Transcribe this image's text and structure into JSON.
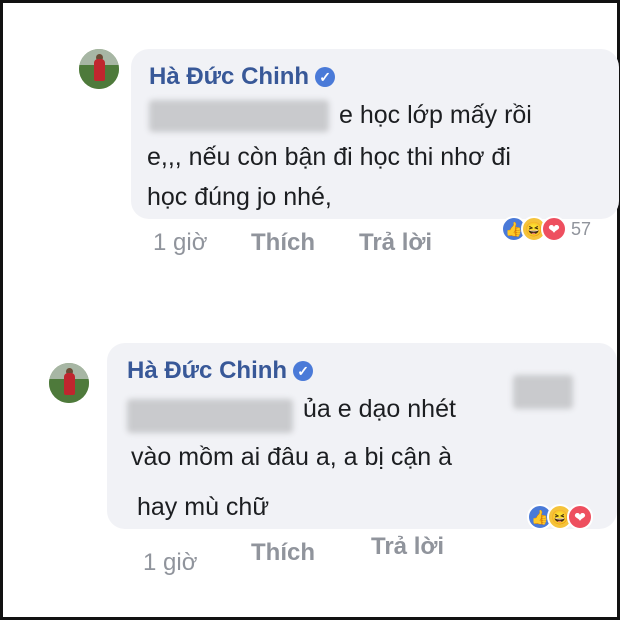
{
  "comments": [
    {
      "author": "Hà Đức Chinh",
      "lines": [
        "e học lớp mấy rồi",
        "e,,, nếu còn bận đi học thi nhơ đi",
        "học đúng jo nhé,"
      ],
      "time": "1 giờ",
      "like_label": "Thích",
      "reply_label": "Trả lời",
      "reaction_count": "57",
      "reactions": [
        "like-icon",
        "haha-icon",
        "love-icon"
      ]
    },
    {
      "author": "Hà Đức Chinh",
      "lines": [
        "ủa e dạo nhét",
        "vào mồm ai đâu a, a bị cận à",
        "hay mù chữ"
      ],
      "time": "1 giờ",
      "like_label": "Thích",
      "reply_label": "Trả lời",
      "reactions": [
        "like-icon",
        "haha-icon",
        "love-icon"
      ]
    }
  ],
  "colors": {
    "name": "#385898",
    "bubble": "#f1f2f6",
    "meta": "#90949c",
    "like": "#4a7ad8",
    "haha": "#f5c33b",
    "love": "#ee4f5f"
  }
}
